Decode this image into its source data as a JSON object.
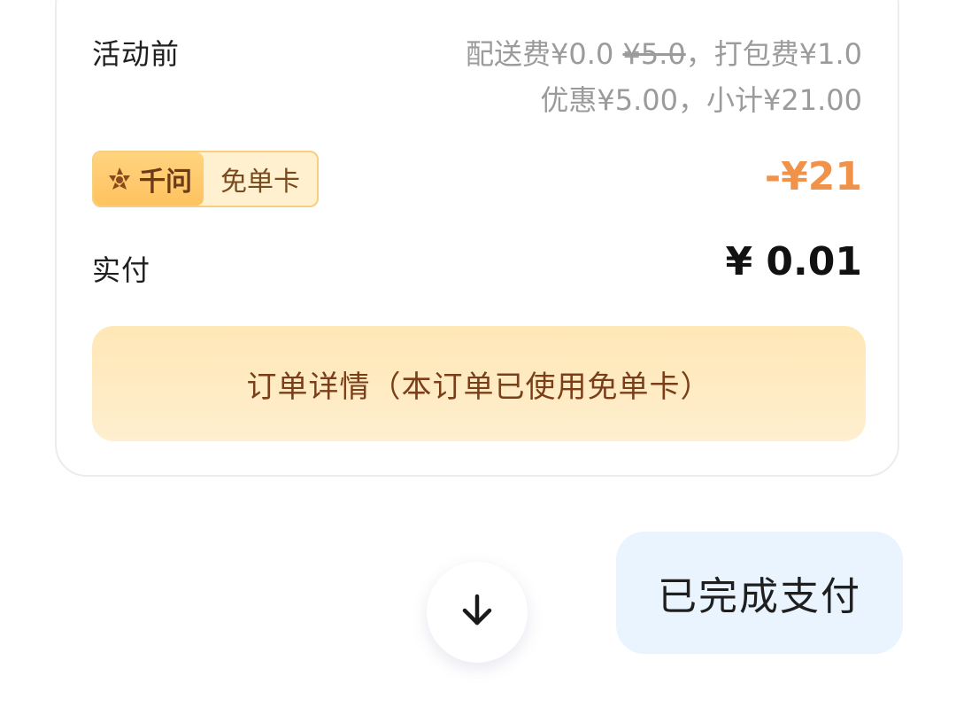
{
  "order": {
    "label_before": "活动前",
    "fees": {
      "delivery_label": "配送费",
      "delivery_value": "¥0.0",
      "delivery_original": "¥5.0",
      "packing_sep": "，",
      "packing_label": "打包费",
      "packing_value": "¥1.0",
      "discount_label": "优惠",
      "discount_value": "¥5.00",
      "subtotal_sep": "，",
      "subtotal_label": "小计",
      "subtotal_value": "¥21.00"
    },
    "badge": {
      "icon": "qianwen-star-icon",
      "brand": "千问",
      "card_name": "免单卡"
    },
    "discount_amount": "-¥21",
    "label_paid": "实付",
    "paid_amount": "¥ 0.01",
    "detail_button": "订单详情（本订单已使用免单卡）"
  },
  "scroll": {
    "icon": "arrow-down-icon"
  },
  "chat": {
    "bubble_text": "已完成支付"
  },
  "colors": {
    "discount": "#f0924a",
    "detail_button_text": "#7a3e19",
    "bubble_bg": "#e9f4ff",
    "muted_text": "#9b9b9b"
  }
}
